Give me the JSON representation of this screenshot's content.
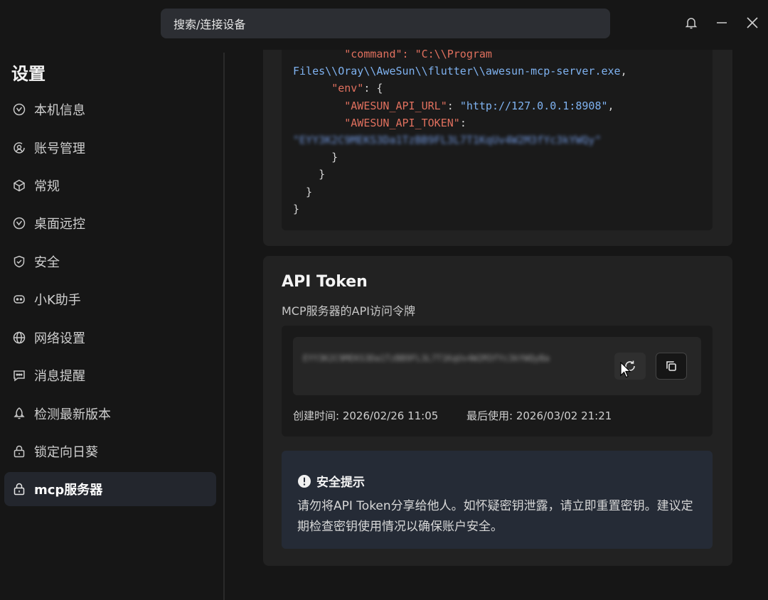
{
  "search": {
    "placeholder": "搜索/连接设备"
  },
  "sidebar": {
    "title": "设置",
    "items": [
      {
        "label": "本机信息",
        "icon": "device-info-icon"
      },
      {
        "label": "账号管理",
        "icon": "account-icon"
      },
      {
        "label": "常规",
        "icon": "cube-icon"
      },
      {
        "label": "桌面远控",
        "icon": "remote-desktop-icon"
      },
      {
        "label": "安全",
        "icon": "shield-icon"
      },
      {
        "label": "小K助手",
        "icon": "robot-icon"
      },
      {
        "label": "网络设置",
        "icon": "globe-icon"
      },
      {
        "label": "消息提醒",
        "icon": "message-icon"
      },
      {
        "label": "检测最新版本",
        "icon": "rocket-icon"
      },
      {
        "label": "锁定向日葵",
        "icon": "lock-icon"
      },
      {
        "label": "mcp服务器",
        "icon": "server-icon",
        "active": true
      }
    ]
  },
  "config_code": {
    "line_command_cut": "\"command\": \"C:\\\\Program",
    "line_path": "Files\\\\Oray\\\\AweSun\\\\flutter\\\\awesun-mcp-server.exe",
    "env_key": "\"env\"",
    "api_url_key": "\"AWESUN_API_URL\"",
    "api_url_value": "\"http://127.0.0.1:8908\"",
    "api_token_key": "\"AWESUN_API_TOKEN\"",
    "api_token_value_blurred": "\"EYY3K2C9MEKS3Da1TzBB9FL3L7T1KqUv4W2M3fYc3kYWQy\""
  },
  "api_token": {
    "title": "API Token",
    "subtitle": "MCP服务器的API访问令牌",
    "value_blurred": "EYY3K2C9MEKS3Da1TzBB9FL3L7T1KqUv4W2M3fYc3kYWQyBa",
    "created_label": "创建时间:",
    "created_value": "2026/02/26 11:05",
    "last_used_label": "最后使用:",
    "last_used_value": "2026/03/02 21:21"
  },
  "security_tip": {
    "title": "安全提示",
    "body": "请勿将API Token分享给他人。如怀疑密钥泄露，请立即重置密钥。建议定期检查密钥使用情况以确保账户安全。"
  },
  "colors": {
    "background": "#161616",
    "card": "#222222",
    "active_nav": "#23262d",
    "json_key": "#e0705e",
    "json_string": "#7fb2f0",
    "tip_bg": "#252b36"
  }
}
